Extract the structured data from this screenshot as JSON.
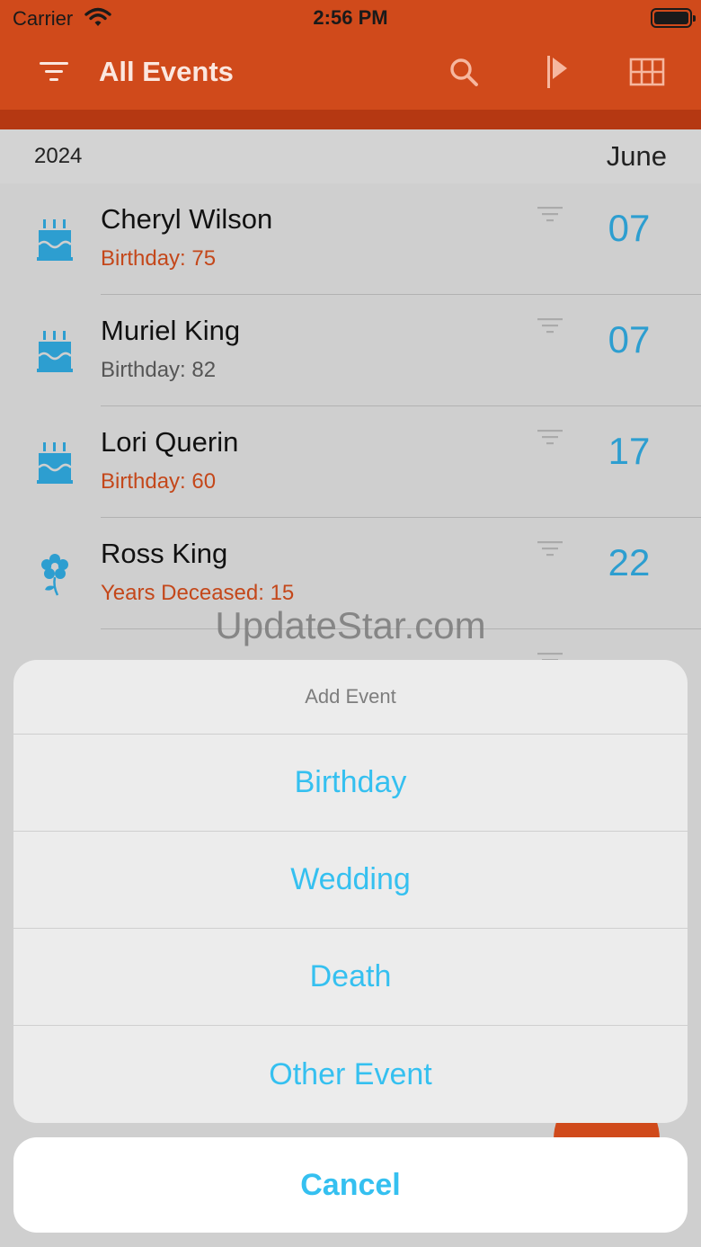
{
  "status": {
    "carrier": "Carrier",
    "time": "2:56 PM"
  },
  "nav": {
    "title": "All Events"
  },
  "section": {
    "year": "2024",
    "month": "June"
  },
  "events": [
    {
      "name": "Cheryl Wilson",
      "sub": "Birthday: 75",
      "day": "07",
      "icon": "birthday-cake-icon",
      "subcolor": "orange"
    },
    {
      "name": "Muriel King",
      "sub": "Birthday: 82",
      "day": "07",
      "icon": "birthday-cake-icon",
      "subcolor": "gray"
    },
    {
      "name": "Lori Querin",
      "sub": "Birthday: 60",
      "day": "17",
      "icon": "birthday-cake-icon",
      "subcolor": "orange"
    },
    {
      "name": "Ross King",
      "sub": "Years Deceased: 15",
      "day": "22",
      "icon": "flower-icon",
      "subcolor": "orange"
    }
  ],
  "watermark": "UpdateStar.com",
  "sheet": {
    "title": "Add Event",
    "options": [
      "Birthday",
      "Wedding",
      "Death",
      "Other Event"
    ],
    "cancel": "Cancel"
  },
  "colors": {
    "accent": "#d04a1b",
    "link": "#35c0f0",
    "day": "#2d9ed0"
  }
}
